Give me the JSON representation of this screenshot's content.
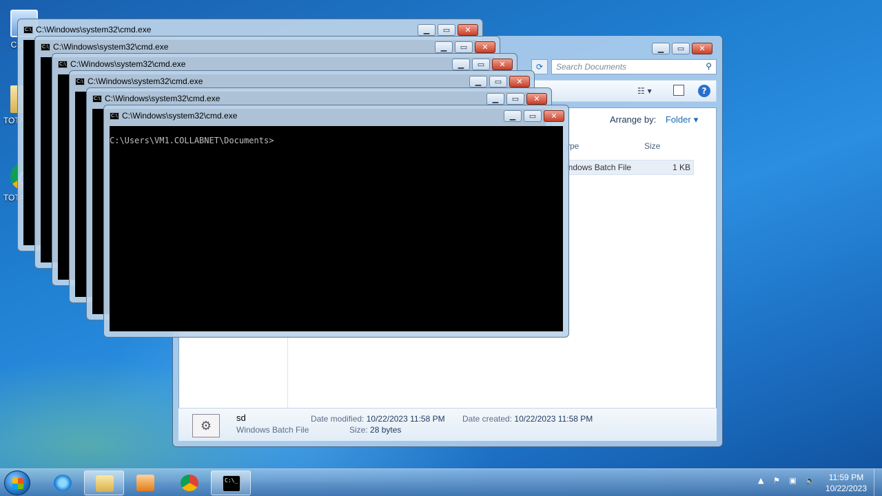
{
  "desktop": {
    "icons": [
      {
        "label": "Compu",
        "icon": "computer-icon"
      },
      {
        "label": "TOTALGI...",
        "icon": "folder-icon"
      },
      {
        "label": "TOTALGI...",
        "icon": "chrome-icon"
      }
    ]
  },
  "explorer": {
    "search_placeholder": "Search Documents",
    "arrange_label": "Arrange by:",
    "arrange_value": "Folder",
    "col_type": "ype",
    "col_size": "Size",
    "row_type": "indows Batch File",
    "row_size": "1 KB",
    "details": {
      "name": "sd",
      "type": "Windows Batch File",
      "modified_label": "Date modified:",
      "modified_value": "10/22/2023 11:58 PM",
      "created_label": "Date created:",
      "created_value": "10/22/2023 11:58 PM",
      "size_label": "Size:",
      "size_value": "28 bytes"
    }
  },
  "cmd": {
    "title": "C:\\Windows\\system32\\cmd.exe",
    "prompt": "C:\\Users\\VM1.COLLABNET\\Documents>",
    "caption_min": "▁",
    "caption_max": "▭",
    "caption_close": "✕"
  },
  "taskbar": {
    "pinned": [
      "ie-icon",
      "explorer-icon",
      "media-player-icon",
      "chrome-icon",
      "cmd-icon"
    ],
    "time": "11:59 PM",
    "date": "10/22/2023"
  }
}
